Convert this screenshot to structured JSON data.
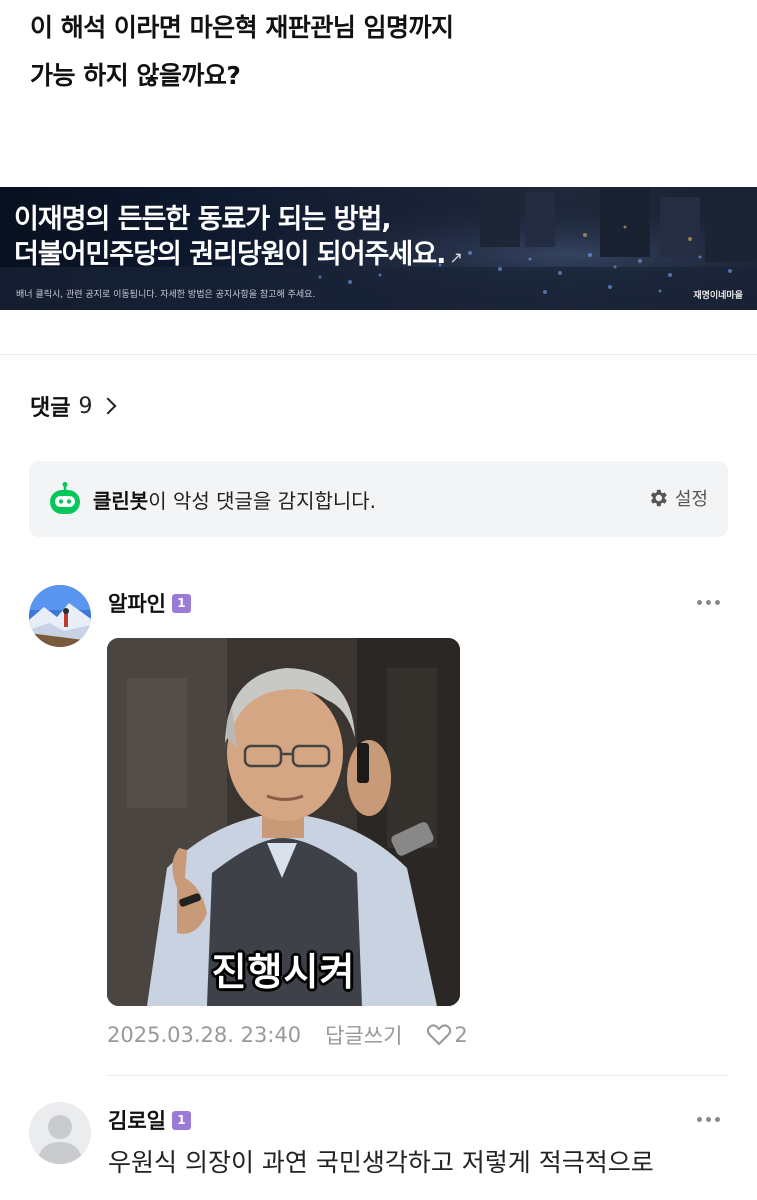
{
  "post": {
    "title_line1": "이 해석 이라면 마은혁 재판관님 임명까지",
    "title_line2": "가능 하지 않을까요?"
  },
  "banner": {
    "line1": "이재명의 든든한 동료가 되는 방법,",
    "line2": "더불어민주당의 권리당원이 되어주세요.",
    "arrow": "↗",
    "note": "배너 클릭시, 관련 공지로 이동됩니다. 자세한 방법은 공지사항을 참고해 주세요.",
    "brand": "재명이네마을"
  },
  "comments_header": {
    "label": "댓글",
    "count": "9"
  },
  "cleanbot": {
    "name": "클린봇",
    "message": "이 악성 댓글을 감지합니다.",
    "settings_label": "설정",
    "icon": "robot-icon",
    "accent": "#03c75a"
  },
  "comments": [
    {
      "author": "알파인",
      "badge": "1",
      "image_caption": "진행시켜",
      "timestamp": "2025.03.28. 23:40",
      "reply_label": "답글쓰기",
      "likes": "2"
    },
    {
      "author": "김로일",
      "badge": "1",
      "text": "우원식 의장이 과연 국민생각하고 저렇게 적극적으로"
    }
  ],
  "colors": {
    "badge": "#9b7bd8",
    "muted": "#999999"
  }
}
